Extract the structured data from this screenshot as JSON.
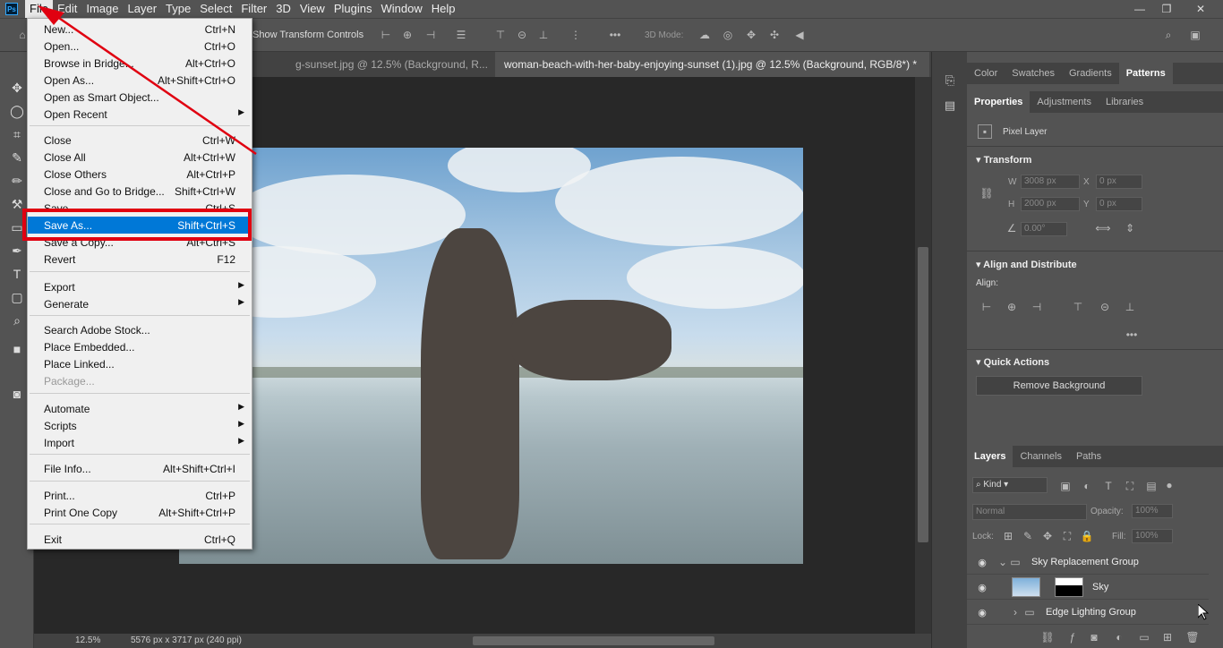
{
  "menubar": {
    "logo": "Ps",
    "items": [
      "File",
      "Edit",
      "Image",
      "Layer",
      "Type",
      "Select",
      "Filter",
      "3D",
      "View",
      "Plugins",
      "Window",
      "Help"
    ],
    "active": "File"
  },
  "options": {
    "transform_label": "Show Transform Controls",
    "mode_3d": "3D Mode:"
  },
  "tabs": [
    {
      "label": "g-sunset.jpg @ 12.5% (Background, R...",
      "active": false
    },
    {
      "label": "woman-beach-with-her-baby-enjoying-sunset (1).jpg @ 12.5% (Background, RGB/8*) *",
      "active": true
    }
  ],
  "status": {
    "zoom": "12.5%",
    "doc_info": "5576 px x 3717 px (240 ppi)"
  },
  "file_menu": {
    "items": [
      {
        "label": "New...",
        "shortcut": "Ctrl+N"
      },
      {
        "label": "Open...",
        "shortcut": "Ctrl+O"
      },
      {
        "label": "Browse in Bridge...",
        "shortcut": "Alt+Ctrl+O"
      },
      {
        "label": "Open As...",
        "shortcut": "Alt+Shift+Ctrl+O"
      },
      {
        "label": "Open as Smart Object...",
        "shortcut": ""
      },
      {
        "label": "Open Recent",
        "shortcut": "",
        "submenu": true
      },
      {
        "label": "Close",
        "shortcut": "Ctrl+W"
      },
      {
        "label": "Close All",
        "shortcut": "Alt+Ctrl+W"
      },
      {
        "label": "Close Others",
        "shortcut": "Alt+Ctrl+P"
      },
      {
        "label": "Close and Go to Bridge...",
        "shortcut": "Shift+Ctrl+W"
      },
      {
        "label": "Save",
        "shortcut": "Ctrl+S"
      },
      {
        "label": "Save As...",
        "shortcut": "Shift+Ctrl+S",
        "highlighted": true
      },
      {
        "label": "Save a Copy...",
        "shortcut": "Alt+Ctrl+S"
      },
      {
        "label": "Revert",
        "shortcut": "F12"
      },
      {
        "label": "Export",
        "shortcut": "",
        "submenu": true
      },
      {
        "label": "Generate",
        "shortcut": "",
        "submenu": true
      },
      {
        "label": "Search Adobe Stock...",
        "shortcut": ""
      },
      {
        "label": "Place Embedded...",
        "shortcut": ""
      },
      {
        "label": "Place Linked...",
        "shortcut": ""
      },
      {
        "label": "Package...",
        "shortcut": "",
        "disabled": true
      },
      {
        "label": "Automate",
        "shortcut": "",
        "submenu": true
      },
      {
        "label": "Scripts",
        "shortcut": "",
        "submenu": true
      },
      {
        "label": "Import",
        "shortcut": "",
        "submenu": true
      },
      {
        "label": "File Info...",
        "shortcut": "Alt+Shift+Ctrl+I"
      },
      {
        "label": "Print...",
        "shortcut": "Ctrl+P"
      },
      {
        "label": "Print One Copy",
        "shortcut": "Alt+Shift+Ctrl+P"
      },
      {
        "label": "Exit",
        "shortcut": "Ctrl+Q"
      }
    ]
  },
  "panels": {
    "top_tabs": [
      "Color",
      "Swatches",
      "Gradients",
      "Patterns"
    ],
    "top_active": "Patterns",
    "prop_tabs": [
      "Properties",
      "Adjustments",
      "Libraries"
    ],
    "prop_active": "Properties",
    "pixel_layer": "Pixel Layer",
    "transform": {
      "title": "Transform",
      "w_label": "W",
      "w_value": "3008 px",
      "x_label": "X",
      "x_value": "0 px",
      "h_label": "H",
      "h_value": "2000 px",
      "y_label": "Y",
      "y_value": "0 px",
      "angle_value": "0.00°"
    },
    "align": {
      "title": "Align and Distribute",
      "align_label": "Align:"
    },
    "quick_actions": {
      "title": "Quick Actions",
      "remove_bg": "Remove Background"
    },
    "layer_tabs": [
      "Layers",
      "Channels",
      "Paths"
    ],
    "layer_active": "Layers",
    "kind_label": "Kind",
    "blend_mode": "Normal",
    "opacity_label": "Opacity:",
    "opacity_value": "100%",
    "lock_label": "Lock:",
    "fill_label": "Fill:",
    "fill_value": "100%",
    "layers": [
      {
        "name": "Sky Replacement Group",
        "type": "group-open"
      },
      {
        "name": "Sky",
        "type": "layer"
      },
      {
        "name": "Edge Lighting Group",
        "type": "group-closed"
      }
    ]
  },
  "colors": {
    "highlight": "#0078d7",
    "annotation": "#e00010"
  }
}
